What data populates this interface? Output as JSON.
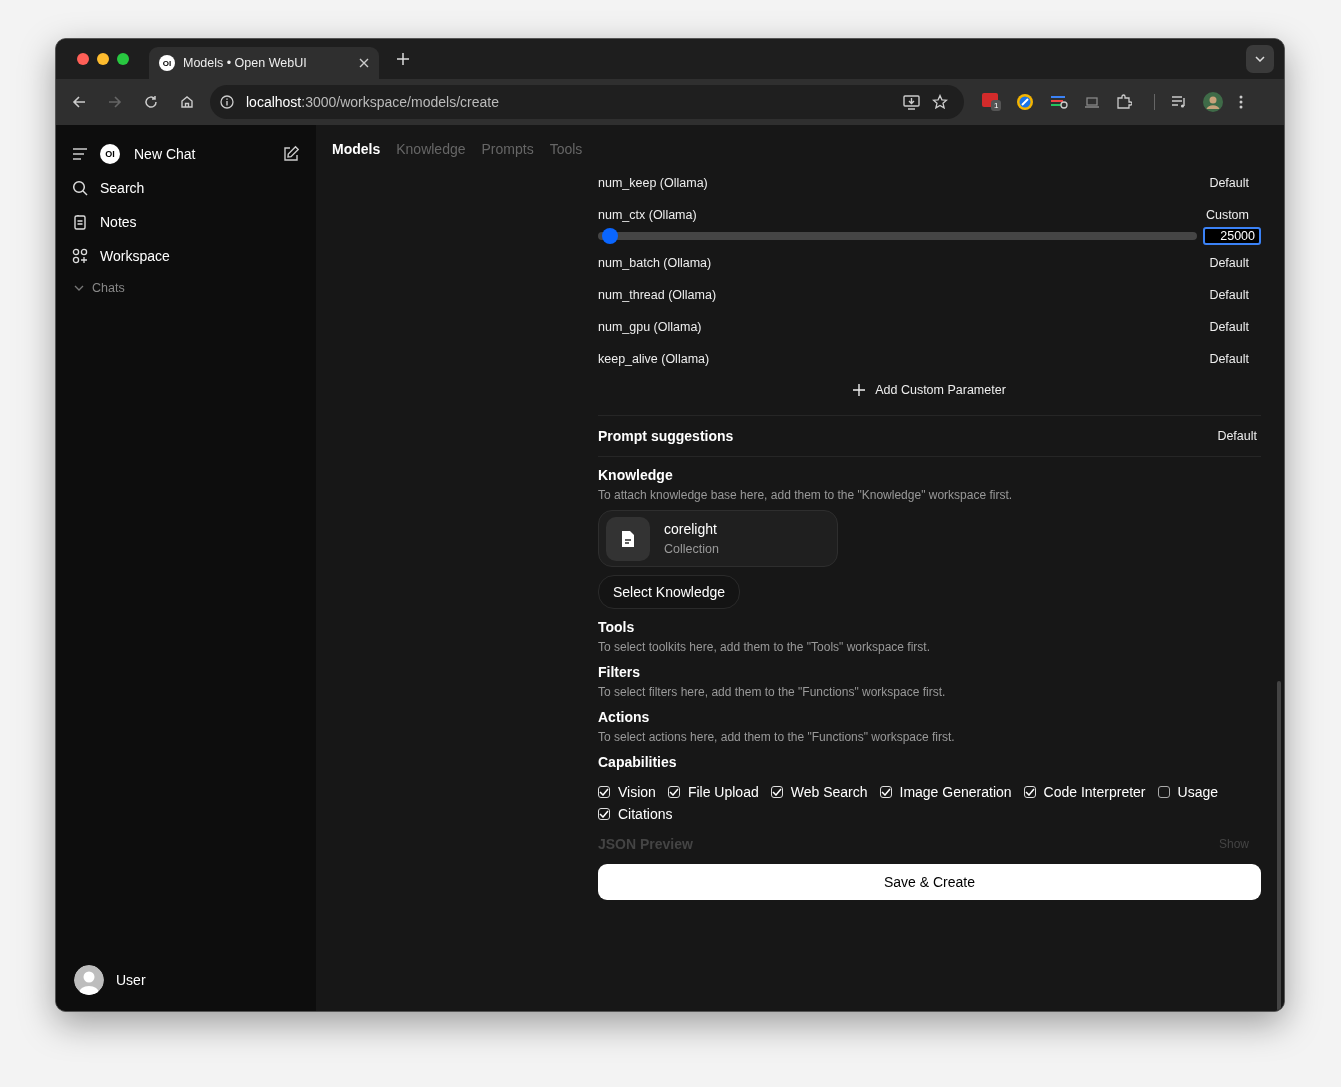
{
  "browser": {
    "tab_title": "Models • Open WebUI",
    "tab_logo": "OI",
    "url_host": "localhost",
    "url_path": ":3000/workspace/models/create",
    "extension_badge": "1"
  },
  "sidebar": {
    "logo": "OI",
    "new_chat": "New Chat",
    "items": [
      {
        "kind": "search",
        "label": "Search"
      },
      {
        "kind": "notes",
        "label": "Notes"
      },
      {
        "kind": "workspace",
        "label": "Workspace"
      }
    ],
    "chats": {
      "label": "Chats",
      "expanded": true
    },
    "user": "User"
  },
  "tabs": [
    {
      "label": "Models",
      "selected": true
    },
    {
      "label": "Knowledge",
      "selected": false
    },
    {
      "label": "Prompts",
      "selected": false
    },
    {
      "label": "Tools",
      "selected": false
    }
  ],
  "params": [
    {
      "kind": "default",
      "name": "num_keep (Ollama)",
      "mode": "Default"
    },
    {
      "kind": "custom",
      "name": "num_ctx (Ollama)",
      "mode": "Custom",
      "level": 0.01,
      "value": "25000"
    },
    {
      "kind": "default",
      "name": "num_batch (Ollama)",
      "mode": "Default"
    },
    {
      "kind": "default",
      "name": "num_thread (Ollama)",
      "mode": "Default"
    },
    {
      "kind": "default",
      "name": "num_gpu (Ollama)",
      "mode": "Default"
    },
    {
      "kind": "default",
      "name": "keep_alive (Ollama)",
      "mode": "Default"
    }
  ],
  "add_param": "Add Custom Parameter",
  "prompt_suggestions": {
    "title": "Prompt suggestions",
    "mode": "Default"
  },
  "knowledge": {
    "title": "Knowledge",
    "description": "To attach knowledge base here, add them to the \"Knowledge\" workspace first.",
    "items": [
      {
        "name": "corelight",
        "type": "Collection"
      }
    ],
    "button": "Select Knowledge"
  },
  "sections": [
    {
      "title": "Tools",
      "description": "To select toolkits here, add them to the \"Tools\" workspace first."
    },
    {
      "title": "Filters",
      "description": "To select filters here, add them to the \"Functions\" workspace first."
    },
    {
      "title": "Actions",
      "description": "To select actions here, add them to the \"Functions\" workspace first."
    }
  ],
  "capabilities": {
    "title": "Capabilities",
    "items": [
      {
        "label": "Vision",
        "checked": true
      },
      {
        "label": "File Upload",
        "checked": true
      },
      {
        "label": "Web Search",
        "checked": true
      },
      {
        "label": "Image Generation",
        "checked": true
      },
      {
        "label": "Code Interpreter",
        "checked": true
      },
      {
        "label": "Usage",
        "checked": false
      },
      {
        "label": "Citations",
        "checked": true
      }
    ]
  },
  "json_preview": {
    "title": "JSON Preview",
    "toggle": "Show"
  },
  "save_button": "Save & Create"
}
